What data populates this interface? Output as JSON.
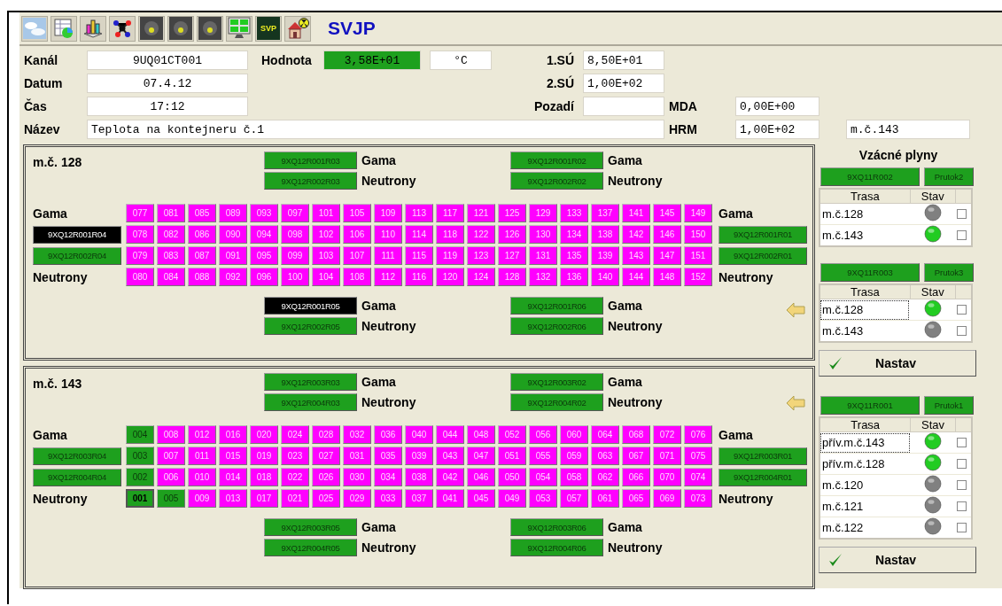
{
  "toolbar": {
    "icons": [
      {
        "kind": "clouds"
      },
      {
        "kind": "sheet"
      },
      {
        "kind": "bars"
      },
      {
        "kind": "molecule"
      },
      {
        "kind": "tile"
      },
      {
        "kind": "tile"
      },
      {
        "kind": "tile"
      },
      {
        "kind": "monitor"
      },
      {
        "kind": "svp",
        "label": "SVP"
      },
      {
        "kind": "house"
      }
    ],
    "title": "SVJP"
  },
  "form": {
    "channel": {
      "label": "Kanál",
      "value": "9UQ01CT001"
    },
    "reading": {
      "label": "Hodnota",
      "value": "3,58E+01",
      "unit": "°C"
    },
    "limit1": {
      "label": "1.SÚ",
      "value": "8,50E+01"
    },
    "date": {
      "label": "Datum",
      "value": "07.4.12"
    },
    "limit2": {
      "label": "2.SÚ",
      "value": "1,00E+02"
    },
    "time": {
      "label": "Čas",
      "value": "17:12"
    },
    "background": {
      "label": "Pozadí"
    },
    "mda": {
      "label": "MDA",
      "value": "0,00E+00"
    },
    "name": {
      "label": "Název",
      "value": "Teplota na kontejneru č.1"
    },
    "hrm": {
      "label": "HRM",
      "value": "1,00E+02"
    },
    "location": {
      "value": "m.č.143"
    }
  },
  "panels": [
    {
      "title": "m.č. 128",
      "arrow_top": false,
      "arrow_bottom": true,
      "top_left": [
        {
          "label": "9XQ12R001R03",
          "color": "#1ea01e",
          "caption": "Gama"
        },
        {
          "label": "9XQ12R002R03",
          "color": "#1ea01e",
          "caption": "Neutrony"
        }
      ],
      "top_right": [
        {
          "label": "9XQ12R001R02",
          "color": "#1ea01e",
          "caption": "Gama"
        },
        {
          "label": "9XQ12R002R02",
          "color": "#1ea01e",
          "caption": "Neutrony"
        }
      ],
      "left": {
        "top_label": "Gama",
        "bottom_label": "Neutrony",
        "detectors": [
          {
            "label": "9XQ12R001R04",
            "color": "#000000"
          },
          {
            "label": "9XQ12R002R04",
            "color": "#1ea01e"
          }
        ]
      },
      "right": {
        "top_label": "Gama",
        "bottom_label": "Neutrony",
        "detectors": [
          {
            "label": "9XQ12R001R01",
            "color": "#1ea01e"
          },
          {
            "label": "9XQ12R002R01",
            "color": "#1ea01e"
          }
        ]
      },
      "grid": [
        [
          {
            "label": "077",
            "color": "#ff00ff",
            "selected": false
          },
          {
            "label": "081",
            "color": "#ff00ff",
            "selected": false
          },
          {
            "label": "085",
            "color": "#ff00ff",
            "selected": false
          },
          {
            "label": "089",
            "color": "#ff00ff",
            "selected": false
          },
          {
            "label": "093",
            "color": "#ff00ff",
            "selected": false
          },
          {
            "label": "097",
            "color": "#ff00ff",
            "selected": false
          },
          {
            "label": "101",
            "color": "#ff00ff",
            "selected": false
          },
          {
            "label": "105",
            "color": "#ff00ff",
            "selected": false
          },
          {
            "label": "109",
            "color": "#ff00ff",
            "selected": false
          },
          {
            "label": "113",
            "color": "#ff00ff",
            "selected": false
          },
          {
            "label": "117",
            "color": "#ff00ff",
            "selected": false
          },
          {
            "label": "121",
            "color": "#ff00ff",
            "selected": false
          },
          {
            "label": "125",
            "color": "#ff00ff",
            "selected": false
          },
          {
            "label": "129",
            "color": "#ff00ff",
            "selected": false
          },
          {
            "label": "133",
            "color": "#ff00ff",
            "selected": false
          },
          {
            "label": "137",
            "color": "#ff00ff",
            "selected": false
          },
          {
            "label": "141",
            "color": "#ff00ff",
            "selected": false
          },
          {
            "label": "145",
            "color": "#ff00ff",
            "selected": false
          },
          {
            "label": "149",
            "color": "#ff00ff",
            "selected": false
          }
        ],
        [
          {
            "label": "078",
            "color": "#ff00ff",
            "selected": false
          },
          {
            "label": "082",
            "color": "#ff00ff",
            "selected": false
          },
          {
            "label": "086",
            "color": "#ff00ff",
            "selected": false
          },
          {
            "label": "090",
            "color": "#ff00ff",
            "selected": false
          },
          {
            "label": "094",
            "color": "#ff00ff",
            "selected": false
          },
          {
            "label": "098",
            "color": "#ff00ff",
            "selected": false
          },
          {
            "label": "102",
            "color": "#ff00ff",
            "selected": false
          },
          {
            "label": "106",
            "color": "#ff00ff",
            "selected": false
          },
          {
            "label": "110",
            "color": "#ff00ff",
            "selected": false
          },
          {
            "label": "114",
            "color": "#ff00ff",
            "selected": false
          },
          {
            "label": "118",
            "color": "#ff00ff",
            "selected": false
          },
          {
            "label": "122",
            "color": "#ff00ff",
            "selected": false
          },
          {
            "label": "126",
            "color": "#ff00ff",
            "selected": false
          },
          {
            "label": "130",
            "color": "#ff00ff",
            "selected": false
          },
          {
            "label": "134",
            "color": "#ff00ff",
            "selected": false
          },
          {
            "label": "138",
            "color": "#ff00ff",
            "selected": false
          },
          {
            "label": "142",
            "color": "#ff00ff",
            "selected": false
          },
          {
            "label": "146",
            "color": "#ff00ff",
            "selected": false
          },
          {
            "label": "150",
            "color": "#ff00ff",
            "selected": false
          }
        ],
        [
          {
            "label": "079",
            "color": "#ff00ff",
            "selected": false
          },
          {
            "label": "083",
            "color": "#ff00ff",
            "selected": false
          },
          {
            "label": "087",
            "color": "#ff00ff",
            "selected": false
          },
          {
            "label": "091",
            "color": "#ff00ff",
            "selected": false
          },
          {
            "label": "095",
            "color": "#ff00ff",
            "selected": false
          },
          {
            "label": "099",
            "color": "#ff00ff",
            "selected": false
          },
          {
            "label": "103",
            "color": "#ff00ff",
            "selected": false
          },
          {
            "label": "107",
            "color": "#ff00ff",
            "selected": false
          },
          {
            "label": "111",
            "color": "#ff00ff",
            "selected": false
          },
          {
            "label": "115",
            "color": "#ff00ff",
            "selected": false
          },
          {
            "label": "119",
            "color": "#ff00ff",
            "selected": false
          },
          {
            "label": "123",
            "color": "#ff00ff",
            "selected": false
          },
          {
            "label": "127",
            "color": "#ff00ff",
            "selected": false
          },
          {
            "label": "131",
            "color": "#ff00ff",
            "selected": false
          },
          {
            "label": "135",
            "color": "#ff00ff",
            "selected": false
          },
          {
            "label": "139",
            "color": "#ff00ff",
            "selected": false
          },
          {
            "label": "143",
            "color": "#ff00ff",
            "selected": false
          },
          {
            "label": "147",
            "color": "#ff00ff",
            "selected": false
          },
          {
            "label": "151",
            "color": "#ff00ff",
            "selected": false
          }
        ],
        [
          {
            "label": "080",
            "color": "#ff00ff",
            "selected": false
          },
          {
            "label": "084",
            "color": "#ff00ff",
            "selected": false
          },
          {
            "label": "088",
            "color": "#ff00ff",
            "selected": false
          },
          {
            "label": "092",
            "color": "#ff00ff",
            "selected": false
          },
          {
            "label": "096",
            "color": "#ff00ff",
            "selected": false
          },
          {
            "label": "100",
            "color": "#ff00ff",
            "selected": false
          },
          {
            "label": "104",
            "color": "#ff00ff",
            "selected": false
          },
          {
            "label": "108",
            "color": "#ff00ff",
            "selected": false
          },
          {
            "label": "112",
            "color": "#ff00ff",
            "selected": false
          },
          {
            "label": "116",
            "color": "#ff00ff",
            "selected": false
          },
          {
            "label": "120",
            "color": "#ff00ff",
            "selected": false
          },
          {
            "label": "124",
            "color": "#ff00ff",
            "selected": false
          },
          {
            "label": "128",
            "color": "#ff00ff",
            "selected": false
          },
          {
            "label": "132",
            "color": "#ff00ff",
            "selected": false
          },
          {
            "label": "136",
            "color": "#ff00ff",
            "selected": false
          },
          {
            "label": "140",
            "color": "#ff00ff",
            "selected": false
          },
          {
            "label": "144",
            "color": "#ff00ff",
            "selected": false
          },
          {
            "label": "148",
            "color": "#ff00ff",
            "selected": false
          },
          {
            "label": "152",
            "color": "#ff00ff",
            "selected": false
          }
        ]
      ],
      "bottom_left": [
        {
          "label": "9XQ12R001R05",
          "color": "#000000",
          "caption": "Gama"
        },
        {
          "label": "9XQ12R002R05",
          "color": "#1ea01e",
          "caption": "Neutrony"
        }
      ],
      "bottom_right": [
        {
          "label": "9XQ12R001R06",
          "color": "#1ea01e",
          "caption": "Gama"
        },
        {
          "label": "9XQ12R002R06",
          "color": "#1ea01e",
          "caption": "Neutrony"
        }
      ]
    },
    {
      "title": "m.č. 143",
      "arrow_top": true,
      "arrow_bottom": false,
      "top_left": [
        {
          "label": "9XQ12R003R03",
          "color": "#1ea01e",
          "caption": "Gama"
        },
        {
          "label": "9XQ12R004R03",
          "color": "#1ea01e",
          "caption": "Neutrony"
        }
      ],
      "top_right": [
        {
          "label": "9XQ12R003R02",
          "color": "#1ea01e",
          "caption": "Gama"
        },
        {
          "label": "9XQ12R004R02",
          "color": "#1ea01e",
          "caption": "Neutrony"
        }
      ],
      "left": {
        "top_label": "Gama",
        "bottom_label": "Neutrony",
        "detectors": [
          {
            "label": "9XQ12R003R04",
            "color": "#1ea01e"
          },
          {
            "label": "9XQ12R004R04",
            "color": "#1ea01e"
          }
        ]
      },
      "right": {
        "top_label": "Gama",
        "bottom_label": "Neutrony",
        "detectors": [
          {
            "label": "9XQ12R003R01",
            "color": "#1ea01e"
          },
          {
            "label": "9XQ12R004R01",
            "color": "#1ea01e"
          }
        ]
      },
      "grid": [
        [
          {
            "label": "004",
            "color": "#1ea01e",
            "selected": false
          },
          {
            "label": "008",
            "color": "#ff00ff",
            "selected": false
          },
          {
            "label": "012",
            "color": "#ff00ff",
            "selected": false
          },
          {
            "label": "016",
            "color": "#ff00ff",
            "selected": false
          },
          {
            "label": "020",
            "color": "#ff00ff",
            "selected": false
          },
          {
            "label": "024",
            "color": "#ff00ff",
            "selected": false
          },
          {
            "label": "028",
            "color": "#ff00ff",
            "selected": false
          },
          {
            "label": "032",
            "color": "#ff00ff",
            "selected": false
          },
          {
            "label": "036",
            "color": "#ff00ff",
            "selected": false
          },
          {
            "label": "040",
            "color": "#ff00ff",
            "selected": false
          },
          {
            "label": "044",
            "color": "#ff00ff",
            "selected": false
          },
          {
            "label": "048",
            "color": "#ff00ff",
            "selected": false
          },
          {
            "label": "052",
            "color": "#ff00ff",
            "selected": false
          },
          {
            "label": "056",
            "color": "#ff00ff",
            "selected": false
          },
          {
            "label": "060",
            "color": "#ff00ff",
            "selected": false
          },
          {
            "label": "064",
            "color": "#ff00ff",
            "selected": false
          },
          {
            "label": "068",
            "color": "#ff00ff",
            "selected": false
          },
          {
            "label": "072",
            "color": "#ff00ff",
            "selected": false
          },
          {
            "label": "076",
            "color": "#ff00ff",
            "selected": false
          }
        ],
        [
          {
            "label": "003",
            "color": "#1ea01e",
            "selected": false
          },
          {
            "label": "007",
            "color": "#ff00ff",
            "selected": false
          },
          {
            "label": "011",
            "color": "#ff00ff",
            "selected": false
          },
          {
            "label": "015",
            "color": "#ff00ff",
            "selected": false
          },
          {
            "label": "019",
            "color": "#ff00ff",
            "selected": false
          },
          {
            "label": "023",
            "color": "#ff00ff",
            "selected": false
          },
          {
            "label": "027",
            "color": "#ff00ff",
            "selected": false
          },
          {
            "label": "031",
            "color": "#ff00ff",
            "selected": false
          },
          {
            "label": "035",
            "color": "#ff00ff",
            "selected": false
          },
          {
            "label": "039",
            "color": "#ff00ff",
            "selected": false
          },
          {
            "label": "043",
            "color": "#ff00ff",
            "selected": false
          },
          {
            "label": "047",
            "color": "#ff00ff",
            "selected": false
          },
          {
            "label": "051",
            "color": "#ff00ff",
            "selected": false
          },
          {
            "label": "055",
            "color": "#ff00ff",
            "selected": false
          },
          {
            "label": "059",
            "color": "#ff00ff",
            "selected": false
          },
          {
            "label": "063",
            "color": "#ff00ff",
            "selected": false
          },
          {
            "label": "067",
            "color": "#ff00ff",
            "selected": false
          },
          {
            "label": "071",
            "color": "#ff00ff",
            "selected": false
          },
          {
            "label": "075",
            "color": "#ff00ff",
            "selected": false
          }
        ],
        [
          {
            "label": "002",
            "color": "#1ea01e",
            "selected": false
          },
          {
            "label": "006",
            "color": "#ff00ff",
            "selected": false
          },
          {
            "label": "010",
            "color": "#ff00ff",
            "selected": false
          },
          {
            "label": "014",
            "color": "#ff00ff",
            "selected": false
          },
          {
            "label": "018",
            "color": "#ff00ff",
            "selected": false
          },
          {
            "label": "022",
            "color": "#ff00ff",
            "selected": false
          },
          {
            "label": "026",
            "color": "#ff00ff",
            "selected": false
          },
          {
            "label": "030",
            "color": "#ff00ff",
            "selected": false
          },
          {
            "label": "034",
            "color": "#ff00ff",
            "selected": false
          },
          {
            "label": "038",
            "color": "#ff00ff",
            "selected": false
          },
          {
            "label": "042",
            "color": "#ff00ff",
            "selected": false
          },
          {
            "label": "046",
            "color": "#ff00ff",
            "selected": false
          },
          {
            "label": "050",
            "color": "#ff00ff",
            "selected": false
          },
          {
            "label": "054",
            "color": "#ff00ff",
            "selected": false
          },
          {
            "label": "058",
            "color": "#ff00ff",
            "selected": false
          },
          {
            "label": "062",
            "color": "#ff00ff",
            "selected": false
          },
          {
            "label": "066",
            "color": "#ff00ff",
            "selected": false
          },
          {
            "label": "070",
            "color": "#ff00ff",
            "selected": false
          },
          {
            "label": "074",
            "color": "#ff00ff",
            "selected": false
          }
        ],
        [
          {
            "label": "001",
            "color": "#1ea01e",
            "selected": true
          },
          {
            "label": "005",
            "color": "#1ea01e",
            "selected": false
          },
          {
            "label": "009",
            "color": "#ff00ff",
            "selected": false
          },
          {
            "label": "013",
            "color": "#ff00ff",
            "selected": false
          },
          {
            "label": "017",
            "color": "#ff00ff",
            "selected": false
          },
          {
            "label": "021",
            "color": "#ff00ff",
            "selected": false
          },
          {
            "label": "025",
            "color": "#ff00ff",
            "selected": false
          },
          {
            "label": "029",
            "color": "#ff00ff",
            "selected": false
          },
          {
            "label": "033",
            "color": "#ff00ff",
            "selected": false
          },
          {
            "label": "037",
            "color": "#ff00ff",
            "selected": false
          },
          {
            "label": "041",
            "color": "#ff00ff",
            "selected": false
          },
          {
            "label": "045",
            "color": "#ff00ff",
            "selected": false
          },
          {
            "label": "049",
            "color": "#ff00ff",
            "selected": false
          },
          {
            "label": "053",
            "color": "#ff00ff",
            "selected": false
          },
          {
            "label": "057",
            "color": "#ff00ff",
            "selected": false
          },
          {
            "label": "061",
            "color": "#ff00ff",
            "selected": false
          },
          {
            "label": "065",
            "color": "#ff00ff",
            "selected": false
          },
          {
            "label": "069",
            "color": "#ff00ff",
            "selected": false
          },
          {
            "label": "073",
            "color": "#ff00ff",
            "selected": false
          }
        ]
      ],
      "bottom_left": [
        {
          "label": "9XQ12R003R05",
          "color": "#1ea01e",
          "caption": "Gama"
        },
        {
          "label": "9XQ12R004R05",
          "color": "#1ea01e",
          "caption": "Neutrony"
        }
      ],
      "bottom_right": [
        {
          "label": "9XQ12R003R06",
          "color": "#1ea01e",
          "caption": "Gama"
        },
        {
          "label": "9XQ12R004R06",
          "color": "#1ea01e",
          "caption": "Neutrony"
        }
      ]
    }
  ],
  "gas": {
    "title": "Vzácné plyny",
    "groups": [
      {
        "detector": {
          "label": "9XQ11R002",
          "color": "#1ea01e"
        },
        "flow": {
          "label": "Prutok2",
          "color": "#1ea01e"
        },
        "columns": [
          "Trasa",
          "Stav"
        ],
        "rows": [
          {
            "route": "m.č.128",
            "color": "#808080",
            "checked": false,
            "focused": false
          },
          {
            "route": "m.č.143",
            "color": "#22cc22",
            "checked": false,
            "focused": false
          }
        ]
      },
      {
        "detector": {
          "label": "9XQ11R003",
          "color": "#1ea01e"
        },
        "flow": {
          "label": "Prutok3",
          "color": "#1ea01e"
        },
        "columns": [
          "Trasa",
          "Stav"
        ],
        "rows": [
          {
            "route": "m.č.128",
            "color": "#22cc22",
            "checked": false,
            "focused": true
          },
          {
            "route": "m.č.143",
            "color": "#808080",
            "checked": false,
            "focused": false
          }
        ],
        "button": "Nastav"
      },
      {
        "detector": {
          "label": "9XQ11R001",
          "color": "#1ea01e"
        },
        "flow": {
          "label": "Prutok1",
          "color": "#1ea01e"
        },
        "columns": [
          "Trasa",
          "Stav"
        ],
        "rows": [
          {
            "route": "přív.m.č.143",
            "color": "#22cc22",
            "checked": false,
            "focused": true
          },
          {
            "route": "přív.m.č.128",
            "color": "#22cc22",
            "checked": false,
            "focused": false
          },
          {
            "route": "m.č.120",
            "color": "#808080",
            "checked": false,
            "focused": false
          },
          {
            "route": "m.č.121",
            "color": "#808080",
            "checked": false,
            "focused": false
          },
          {
            "route": "m.č.122",
            "color": "#808080",
            "checked": false,
            "focused": false
          }
        ],
        "button": "Nastav"
      }
    ]
  }
}
